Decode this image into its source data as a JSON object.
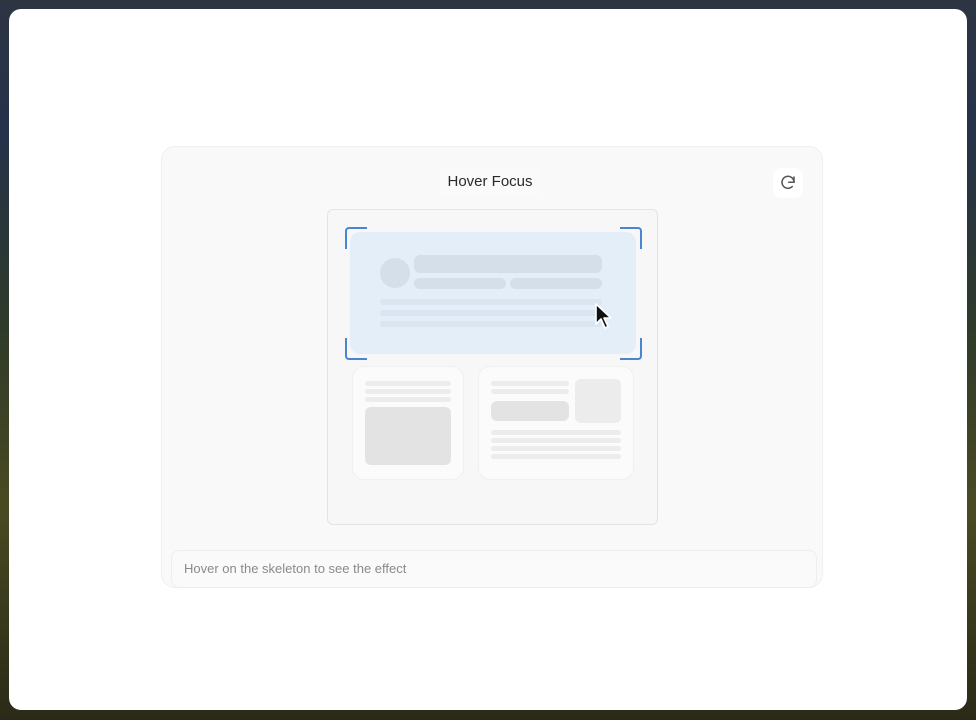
{
  "demo": {
    "title": "Hover Focus",
    "refresh_icon": "refresh-icon",
    "status_text": "Hover on the skeleton to see the effect"
  },
  "colors": {
    "focus_bracket": "#4a86cf",
    "focus_fill": "#e4eef9",
    "skeleton": "#ececec"
  }
}
